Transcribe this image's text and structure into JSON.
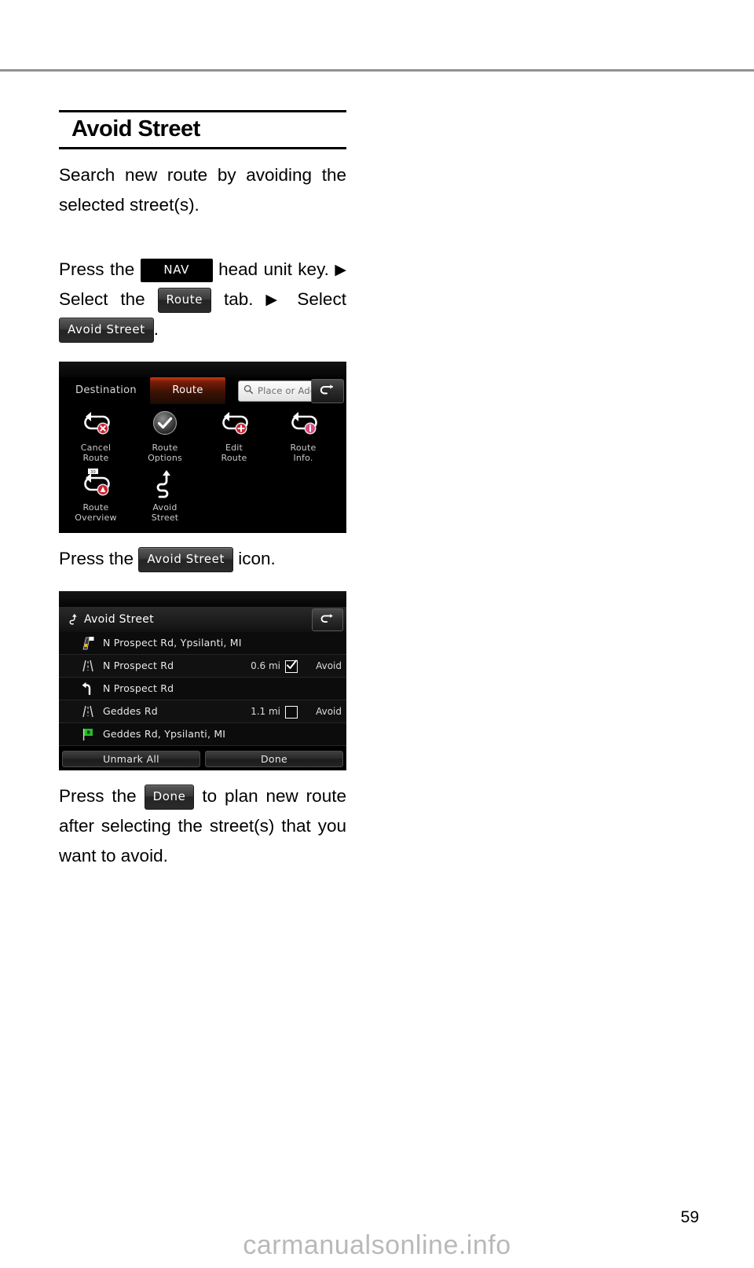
{
  "page": {
    "title": "Avoid Street",
    "number": "59",
    "watermark": "carmanualsonline.info"
  },
  "intro": {
    "paragraph": "Search new route by avoiding the selected street(s)."
  },
  "steps": {
    "line1_pre": "Press the",
    "nav_key": "NAV",
    "line1_post": "head unit key.",
    "arrow": "▶",
    "line2_pre": "Select  the",
    "route_tab": "Route",
    "line2_mid": "tab.",
    "line2_post": "Select",
    "avoid_street_chip": "Avoid Street",
    "period": ".",
    "caption2_pre": "Press the",
    "caption2_chip": "Avoid Street",
    "caption2_post": "icon.",
    "caption3_pre": "Press the",
    "caption3_chip": "Done",
    "caption3_post": "to plan new route after selecting the street(s) that you want to avoid."
  },
  "route_screen": {
    "tabs": [
      {
        "label": "Destination",
        "active": false
      },
      {
        "label": "Route",
        "active": true
      }
    ],
    "search_placeholder": "Place or Address",
    "back_icon": "back-arrow-icon",
    "search_icon": "search-icon",
    "menu": [
      {
        "label_line1": "Cancel",
        "label_line2": "Route",
        "icon": "cancel-route-icon"
      },
      {
        "label_line1": "Route",
        "label_line2": "Options",
        "icon": "route-options-icon"
      },
      {
        "label_line1": "Edit",
        "label_line2": "Route",
        "icon": "edit-route-icon"
      },
      {
        "label_line1": "Route",
        "label_line2": "Info.",
        "icon": "route-info-icon"
      },
      {
        "label_line1": "Route",
        "label_line2": "Overview",
        "icon": "route-overview-icon"
      },
      {
        "label_line1": "Avoid",
        "label_line2": "Street",
        "icon": "avoid-street-icon"
      }
    ]
  },
  "avoid_screen": {
    "header_title": "Avoid Street",
    "header_icon": "avoid-street-icon",
    "back_icon": "back-arrow-icon",
    "rows": [
      {
        "name": "N Prospect Rd, Ypsilanti, MI",
        "distance": "",
        "avoid_label": "",
        "checked": null,
        "icon": "start-flag-icon"
      },
      {
        "name": "N Prospect Rd",
        "distance": "0.6 mi",
        "avoid_label": "Avoid",
        "checked": true,
        "icon": "straight-road-icon"
      },
      {
        "name": "N Prospect Rd",
        "distance": "",
        "avoid_label": "",
        "checked": null,
        "icon": "turn-left-icon"
      },
      {
        "name": "Geddes Rd",
        "distance": "1.1 mi",
        "avoid_label": "Avoid",
        "checked": false,
        "icon": "straight-road-icon"
      },
      {
        "name": "Geddes Rd, Ypsilanti, MI",
        "distance": "",
        "avoid_label": "",
        "checked": null,
        "icon": "destination-flag-icon"
      }
    ],
    "footer_buttons": [
      {
        "label": "Unmark All"
      },
      {
        "label": "Done"
      }
    ]
  },
  "colors": {
    "accent_tab": "#c93b15",
    "screen_bg": "#000000",
    "text_light": "#e8e8e8",
    "rule": "#8e9195"
  }
}
